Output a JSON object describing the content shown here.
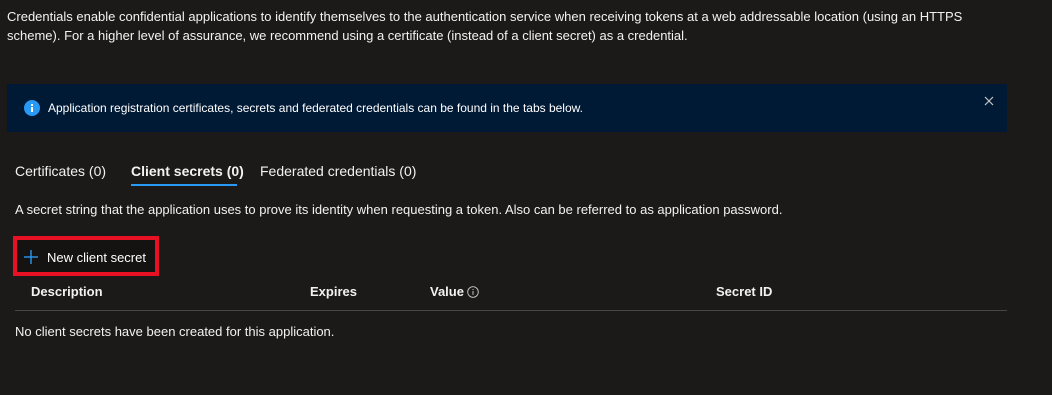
{
  "intro": {
    "text": "Credentials enable confidential applications to identify themselves to the authentication service when receiving tokens at a web addressable location (using an HTTPS scheme). For a higher level of assurance, we recommend using a certificate (instead of a client secret) as a credential."
  },
  "info_bar": {
    "icon": "info-icon",
    "message": "Application registration certificates, secrets and federated credentials can be found in the tabs below.",
    "dismiss_icon": "close-icon",
    "background_color": "#001a36"
  },
  "tabs": [
    {
      "label": "Certificates (0)",
      "active": false
    },
    {
      "label": "Client secrets (0)",
      "active": true
    },
    {
      "label": "Federated credentials (0)",
      "active": false
    }
  ],
  "accent_color": "#2899f5",
  "highlight_color": "#e81123",
  "section": {
    "description": "A secret string that the application uses to prove its identity when requesting a token. Also can be referred to as application password."
  },
  "toolbar": {
    "new_secret_icon": "plus-icon",
    "new_secret_label": "New client secret"
  },
  "table": {
    "columns": [
      {
        "label": "Description"
      },
      {
        "label": "Expires"
      },
      {
        "label": "Value",
        "icon": "info-circle-icon"
      },
      {
        "label": "Secret ID"
      }
    ],
    "empty_message": "No client secrets have been created for this application."
  }
}
